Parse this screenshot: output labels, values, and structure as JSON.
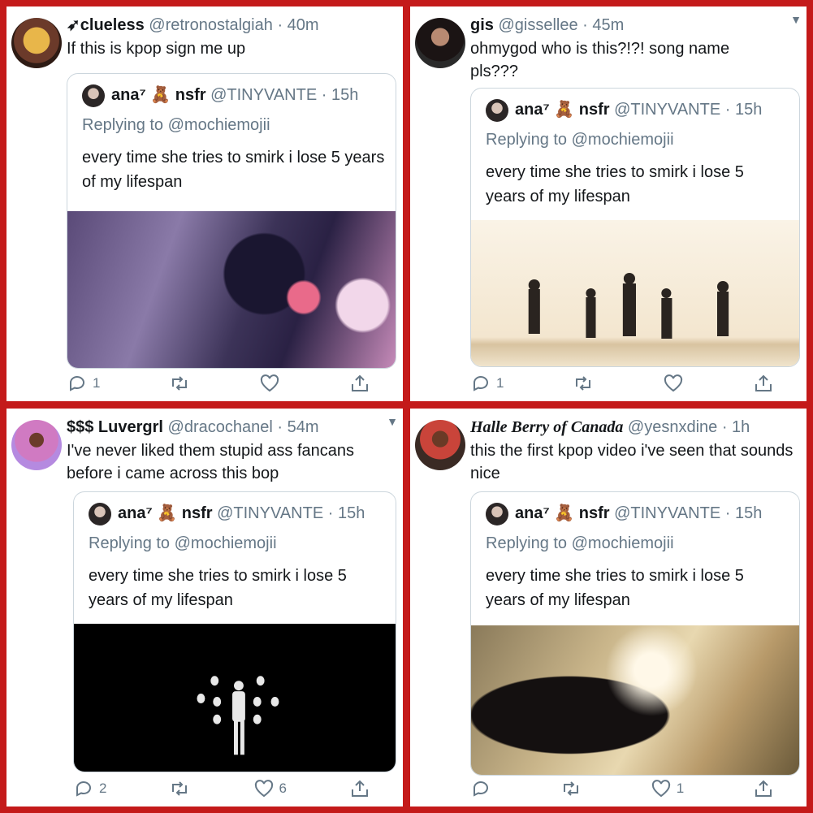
{
  "quoted": {
    "name": "ana⁷",
    "name_suffix": "nsfr",
    "bear": "🧸",
    "handle": "@TINYVANTE",
    "time": "· 15h",
    "reply_label": "Replying to",
    "reply_to": "@mochiemojii",
    "text": "every time she tries to smirk i lose 5 years of my lifespan"
  },
  "tweets": [
    {
      "name": "➶clueless",
      "handle": "@retronostalgiah",
      "time": "· 40m",
      "text": "If this is kpop sign me up",
      "replies": "1",
      "retweets": "",
      "likes": ""
    },
    {
      "name": "gis",
      "handle": "@gissellee",
      "time": "· 45m",
      "text": "ohmygod who is this?!?! song name pls???",
      "replies": "1",
      "retweets": "",
      "likes": ""
    },
    {
      "name": "$$$ Luvergrl",
      "handle": "@dracochanel",
      "time": "· 54m",
      "text": "I've never liked them stupid ass fancans before i came across this bop",
      "replies": "2",
      "retweets": "",
      "likes": "6"
    },
    {
      "name": "Halle Berry of Canada",
      "handle": "@yesnxdine",
      "time": "· 1h",
      "text": "this the first kpop video i've seen that sounds nice",
      "replies": "",
      "retweets": "",
      "likes": "1"
    }
  ]
}
